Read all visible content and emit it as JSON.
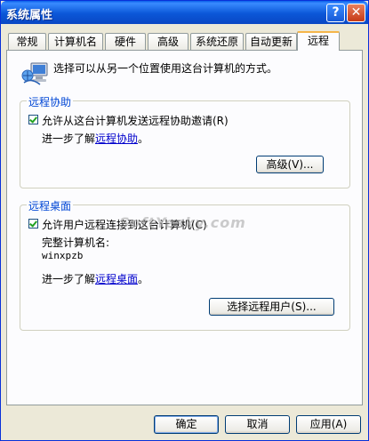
{
  "window": {
    "title": "系统属性",
    "help_glyph": "?",
    "close_glyph": "✕"
  },
  "tabs": [
    {
      "label": "常规"
    },
    {
      "label": "计算机名"
    },
    {
      "label": "硬件"
    },
    {
      "label": "高级"
    },
    {
      "label": "系统还原"
    },
    {
      "label": "自动更新"
    },
    {
      "label": "远程",
      "active": true
    }
  ],
  "intro": {
    "text": "选择可以从另一个位置使用这台计算机的方式。",
    "icon": "network-computer-icon"
  },
  "remote_assistance": {
    "legend": "远程协助",
    "checkbox_label": "允许从这台计算机发送远程协助邀请(R)",
    "checked": true,
    "learn_prefix": "进一步了解",
    "learn_link": "远程协助",
    "learn_suffix": "。",
    "advanced_button": "高级(V)..."
  },
  "remote_desktop": {
    "legend": "远程桌面",
    "checkbox_label": "允许用户远程连接到这台计算机(C)",
    "checked": true,
    "computer_name_label": "完整计算机名:",
    "computer_name_value": "winxpzb",
    "learn_prefix": "进一步了解",
    "learn_link": "远程桌面",
    "learn_suffix": "。",
    "select_users_button": "选择远程用户(S)..."
  },
  "watermark": "SoftYesky.com",
  "footer": {
    "ok": "确定",
    "cancel": "取消",
    "apply": "应用(A)"
  }
}
